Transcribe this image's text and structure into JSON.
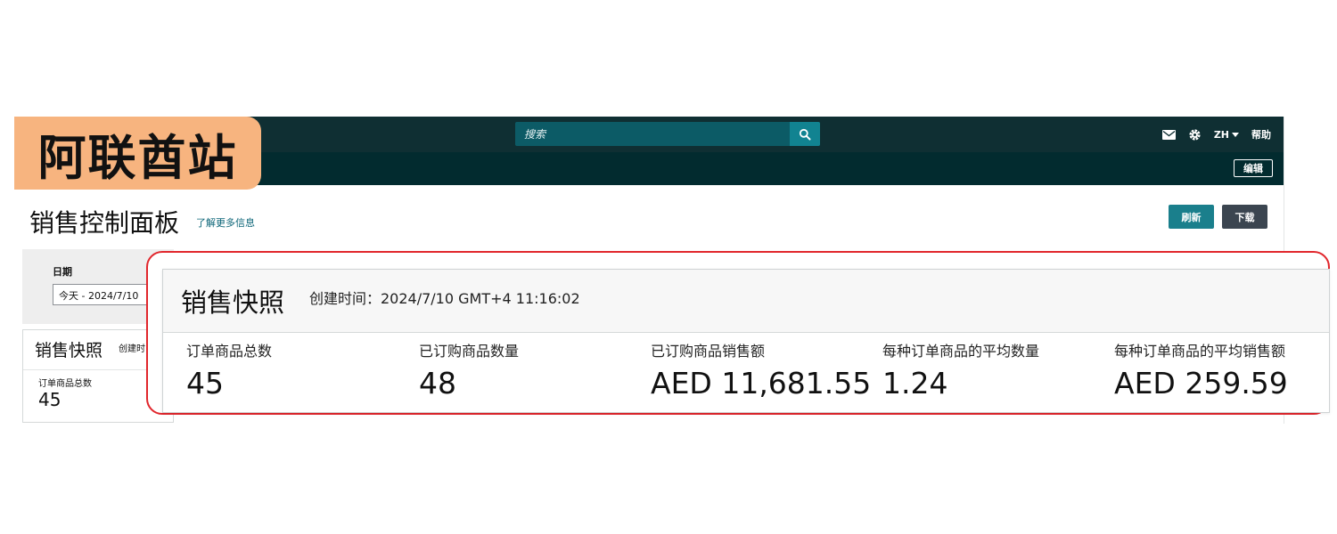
{
  "badge": {
    "label": "阿联酋站"
  },
  "topbar": {
    "search_placeholder": "搜索",
    "lang": "ZH",
    "help": "帮助",
    "edit": "编辑"
  },
  "page": {
    "title": "销售控制面板",
    "learn_more": "了解更多信息",
    "refresh": "刷新",
    "download": "下载"
  },
  "filters": {
    "date_label": "日期",
    "date_value": "今天 - 2024/7/10"
  },
  "background_card": {
    "title": "销售快照",
    "created": "创建时",
    "metric_label": "订单商品总数",
    "metric_value": "45"
  },
  "snapshot": {
    "title": "销售快照",
    "created": "创建时间：2024/7/10 GMT+4 11:16:02",
    "metrics": [
      {
        "label": "订单商品总数",
        "value": "45"
      },
      {
        "label": "已订购商品数量",
        "value": "48"
      },
      {
        "label": "已订购商品销售额",
        "value": "AED 11,681.55"
      },
      {
        "label": "每种订单商品的平均数量",
        "value": "1.24"
      },
      {
        "label": "每种订单商品的平均销售额",
        "value": "AED 259.59"
      }
    ]
  },
  "colors": {
    "topbar": "#0f2f33",
    "accent": "#1a7f8c",
    "highlight": "#e1262c",
    "badge": "#f7b47f"
  }
}
